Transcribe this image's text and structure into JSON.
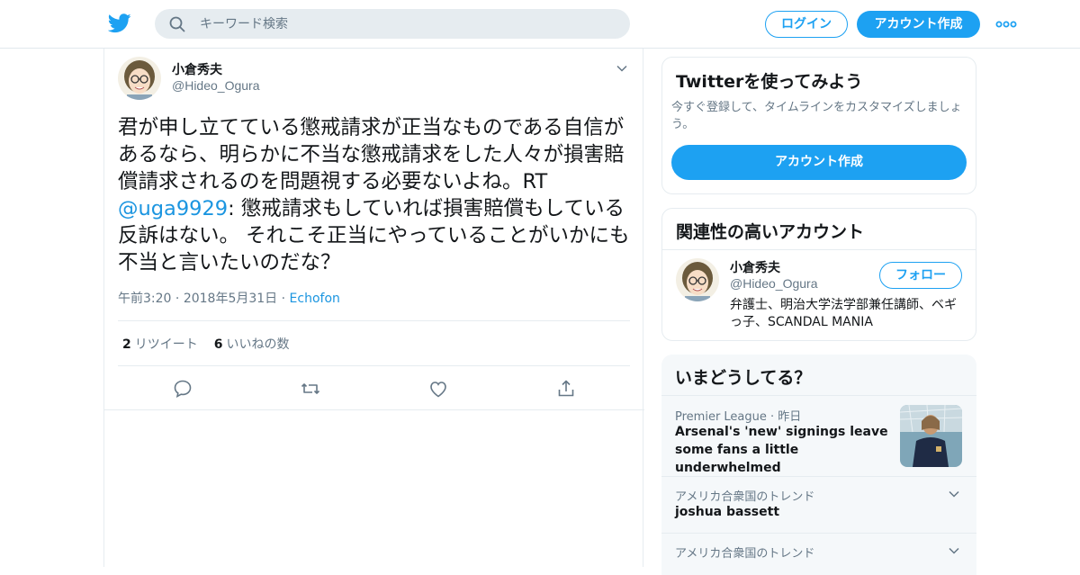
{
  "topbar": {
    "search_placeholder": "キーワード検索",
    "login_label": "ログイン",
    "signup_label": "アカウント作成",
    "brand_color": "#1da1f2"
  },
  "tweet": {
    "author_name": "小倉秀夫",
    "author_handle": "@Hideo_Ogura",
    "text_part1": "君が申し立てている懲戒請求が正当なものである自信があるなら、明らかに不当な懲戒請求をした人々が損害賠償請求されるのを問題視する必要ないよね。RT ",
    "mention": "@uga9929",
    "text_part2": ": 懲戒請求もしていれば損害賠償もしている 反訴はない。 それこそ正当にやっていることがいかにも不当と言いたいのだな？",
    "time": "午前3:20",
    "date": "2018年5月31日",
    "source": "Echofon",
    "meta_sep": "·",
    "retweet_count": "2",
    "retweet_label": "リツイート",
    "like_count": "6",
    "like_label": "いいねの数"
  },
  "signup_card": {
    "title": "Twitterを使ってみよう",
    "subtitle": "今すぐ登録して、タイムラインをカスタマイズしましょう。",
    "cta": "アカウント作成"
  },
  "related_card": {
    "title": "関連性の高いアカウント",
    "name": "小倉秀夫",
    "handle": "@Hideo_Ogura",
    "follow_label": "フォロー",
    "bio": "弁護士、明治大学法学部兼任講師、ベギっ子、SCANDAL MANIA"
  },
  "trends_card": {
    "title": "いまどうしてる？",
    "items": [
      {
        "context": "Premier League · 昨日",
        "title": "Arsenal's 'new' signings leave some fans a little underwhelmed"
      },
      {
        "context": "アメリカ合衆国のトレンド",
        "title": "joshua bassett"
      },
      {
        "context": "アメリカ合衆国のトレンド",
        "title": ""
      }
    ]
  }
}
